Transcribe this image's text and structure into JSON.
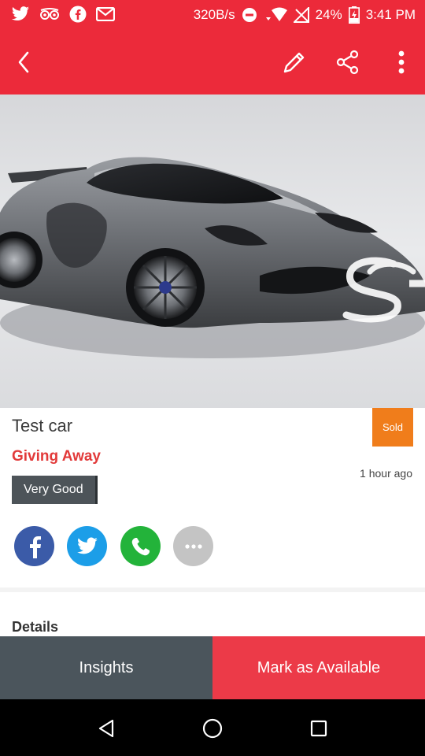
{
  "status_bar": {
    "speed": "320B/s",
    "battery": "24%",
    "time": "3:41 PM",
    "left_icons": [
      "twitter-icon",
      "tripadvisor-icon",
      "facebook-icon",
      "gmail-icon"
    ],
    "right_icons": [
      "do-not-disturb-icon",
      "wifi-icon",
      "no-signal-icon",
      "battery-charging-icon"
    ]
  },
  "app_bar": {
    "icons": [
      "back-icon",
      "edit-icon",
      "share-icon",
      "more-vert-icon"
    ]
  },
  "listing": {
    "title": "Test car",
    "status_badge": "Sold",
    "type_label": "Giving Away",
    "condition": "Very Good",
    "posted": "1 hour ago"
  },
  "share_buttons": [
    {
      "name": "facebook",
      "color": "#3b5ba8"
    },
    {
      "name": "twitter",
      "color": "#1c9ee8"
    },
    {
      "name": "whatsapp",
      "color": "#23b33a"
    },
    {
      "name": "more",
      "color": "#c4c4c4"
    }
  ],
  "details_heading": "Details",
  "actions": {
    "insights": "Insights",
    "mark_available": "Mark as Available"
  },
  "colors": {
    "primary": "#ec2a3a",
    "sold_badge": "#f07d1b",
    "insights_button": "#4b555c",
    "mark_available_button": "#ec3a48"
  }
}
